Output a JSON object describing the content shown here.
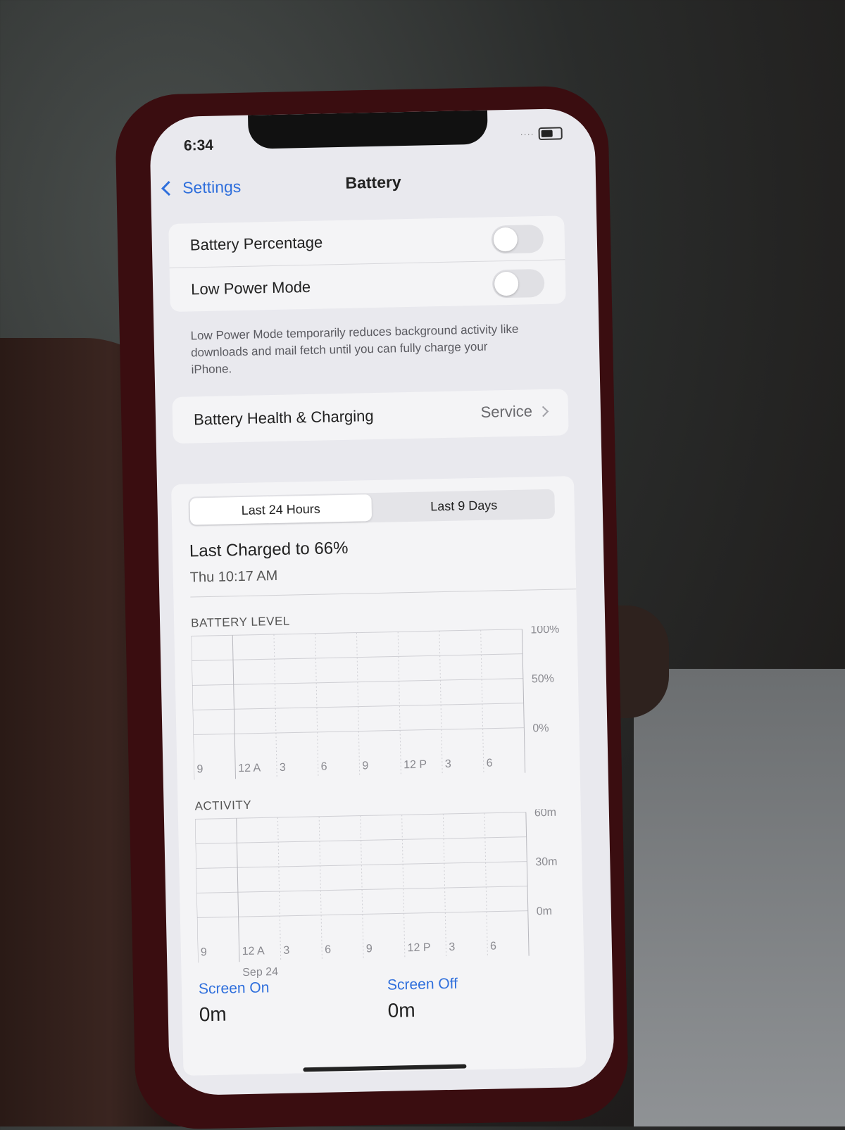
{
  "status_bar": {
    "time": "6:34"
  },
  "nav": {
    "back_label": "Settings",
    "title": "Battery"
  },
  "toggles": [
    {
      "label": "Battery Percentage",
      "on": false
    },
    {
      "label": "Low Power Mode",
      "on": false
    }
  ],
  "low_power_note": "Low Power Mode temporarily reduces background activity like downloads and mail fetch until you can fully charge your iPhone.",
  "health": {
    "label": "Battery Health & Charging",
    "value": "Service"
  },
  "usage": {
    "tabs": [
      "Last 24 Hours",
      "Last 9 Days"
    ],
    "active_tab": "Last 24 Hours",
    "last_charged": "Last Charged to 66%",
    "last_charged_time": "Thu 10:17 AM",
    "battery_level_label": "BATTERY LEVEL",
    "activity_label": "ACTIVITY",
    "date_label": "Sep 24",
    "screen_on_label": "Screen On",
    "screen_on_value": "0m",
    "screen_off_label": "Screen Off",
    "screen_off_value": "0m"
  },
  "chart_data": [
    {
      "type": "bar",
      "title": "BATTERY LEVEL",
      "categories": [
        "9",
        "12 A",
        "3",
        "6",
        "9",
        "12 P",
        "3",
        "6"
      ],
      "y_ticks": [
        "100%",
        "50%",
        "0%"
      ],
      "ylim": [
        0,
        100
      ],
      "series": [
        {
          "values": []
        }
      ],
      "grid": true
    },
    {
      "type": "bar",
      "title": "ACTIVITY",
      "categories": [
        "9",
        "12 A",
        "3",
        "6",
        "9",
        "12 P",
        "3",
        "6"
      ],
      "y_ticks": [
        "60m",
        "30m",
        "0m"
      ],
      "ylim": [
        0,
        60
      ],
      "series": [
        {
          "values": []
        }
      ],
      "grid": true
    }
  ],
  "colors": {
    "accent": "#2f6fdc",
    "background": "#e9e9ee",
    "card": "#f4f4f6"
  }
}
